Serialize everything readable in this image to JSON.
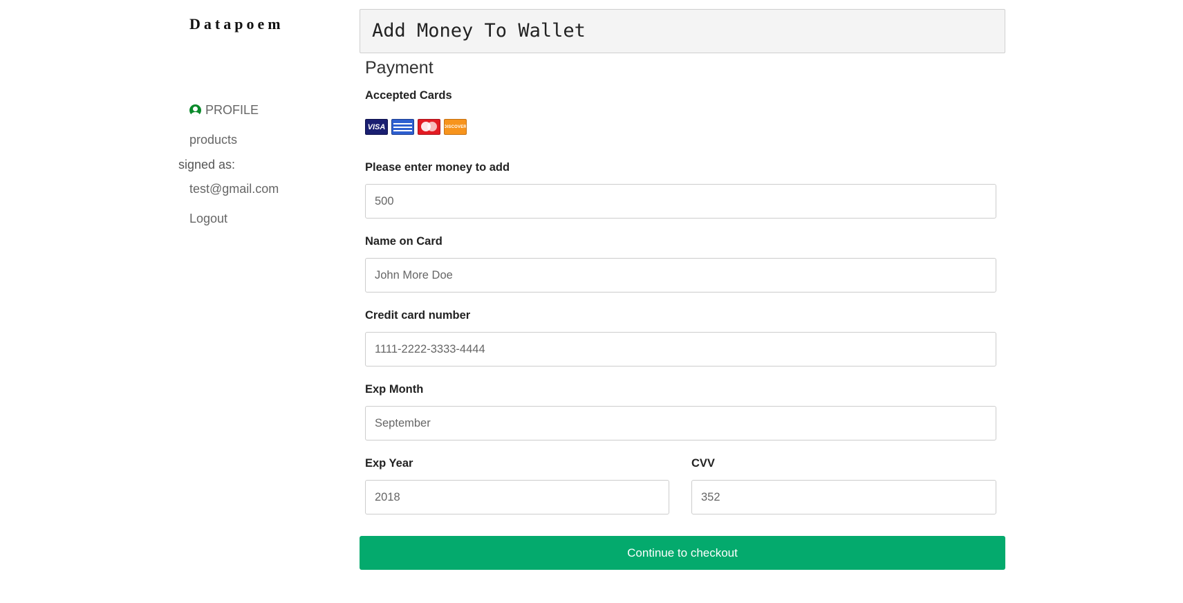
{
  "brand": "Datapoem",
  "sidebar": {
    "profile_label": "PROFILE",
    "products_label": "products",
    "signed_as_label": "signed as:",
    "user_email": "test@gmail.com",
    "logout_label": "Logout",
    "profile_icon_color": "#0a8a2a"
  },
  "main": {
    "title": "Add Money To Wallet",
    "section_title": "Payment",
    "accepted_cards_label": "Accepted Cards",
    "cards": {
      "visa": "VISA",
      "discover": "DISCOVER"
    },
    "amount": {
      "label": "Please enter money to add",
      "placeholder": "500"
    },
    "name": {
      "label": "Name on Card",
      "placeholder": "John More Doe"
    },
    "card_number": {
      "label": "Credit card number",
      "placeholder": "1111-2222-3333-4444"
    },
    "exp_month": {
      "label": "Exp Month",
      "placeholder": "September"
    },
    "exp_year": {
      "label": "Exp Year",
      "placeholder": "2018"
    },
    "cvv": {
      "label": "CVV",
      "placeholder": "352"
    },
    "checkout_label": "Continue to checkout",
    "accent_color": "#04aa6d"
  }
}
